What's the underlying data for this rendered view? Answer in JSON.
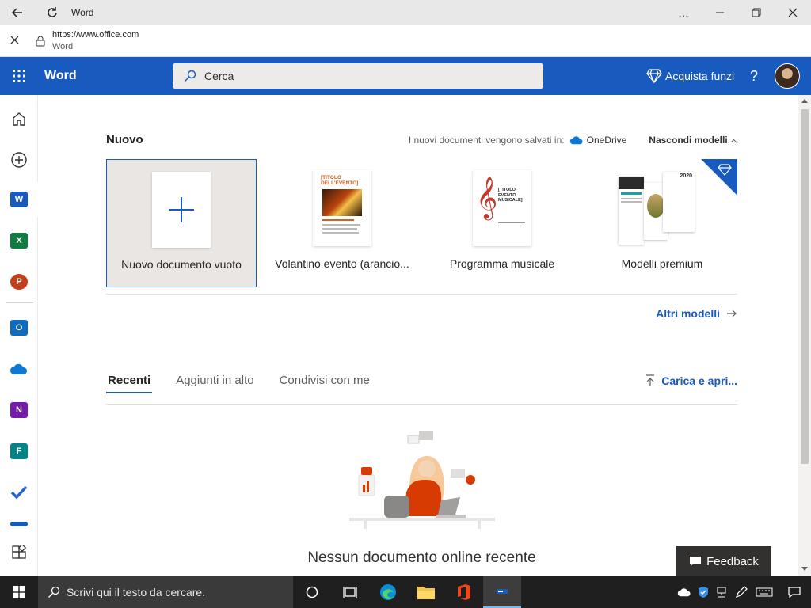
{
  "browser": {
    "tab_title": "Word",
    "url": "https://www.office.com",
    "site_name": "Word",
    "more_label": "…"
  },
  "header": {
    "app_name": "Word",
    "search_placeholder": "Cerca",
    "buy_label": "Acquista funzi",
    "help_label": "?"
  },
  "new_section": {
    "title": "Nuovo",
    "saved_in_label": "I nuovi documenti vengono salvati in:",
    "storage_name": "OneDrive",
    "hide_templates_label": "Nascondi modelli",
    "templates": [
      {
        "label": "Nuovo documento vuoto"
      },
      {
        "label": "Volantino evento (arancio..."
      },
      {
        "label": "Programma musicale"
      },
      {
        "label": "Modelli premium"
      }
    ],
    "flyer_thumb_title": "[TITOLO DELL'EVENTO]",
    "music_thumb_title": "[TITOLO EVENTO MUSICALE]",
    "premium_thumb_year": "2020",
    "more_templates_label": "Altri modelli"
  },
  "recent_section": {
    "tabs": [
      {
        "label": "Recenti"
      },
      {
        "label": "Aggiunti in alto"
      },
      {
        "label": "Condivisi con me"
      }
    ],
    "upload_label": "Carica e apri...",
    "empty_title": "Nessun documento online recente"
  },
  "feedback_label": "Feedback",
  "taskbar": {
    "search_placeholder": "Scrivi qui il testo da cercare."
  },
  "colors": {
    "word_blue": "#185abd",
    "taskbar": "#1f1f1f"
  }
}
